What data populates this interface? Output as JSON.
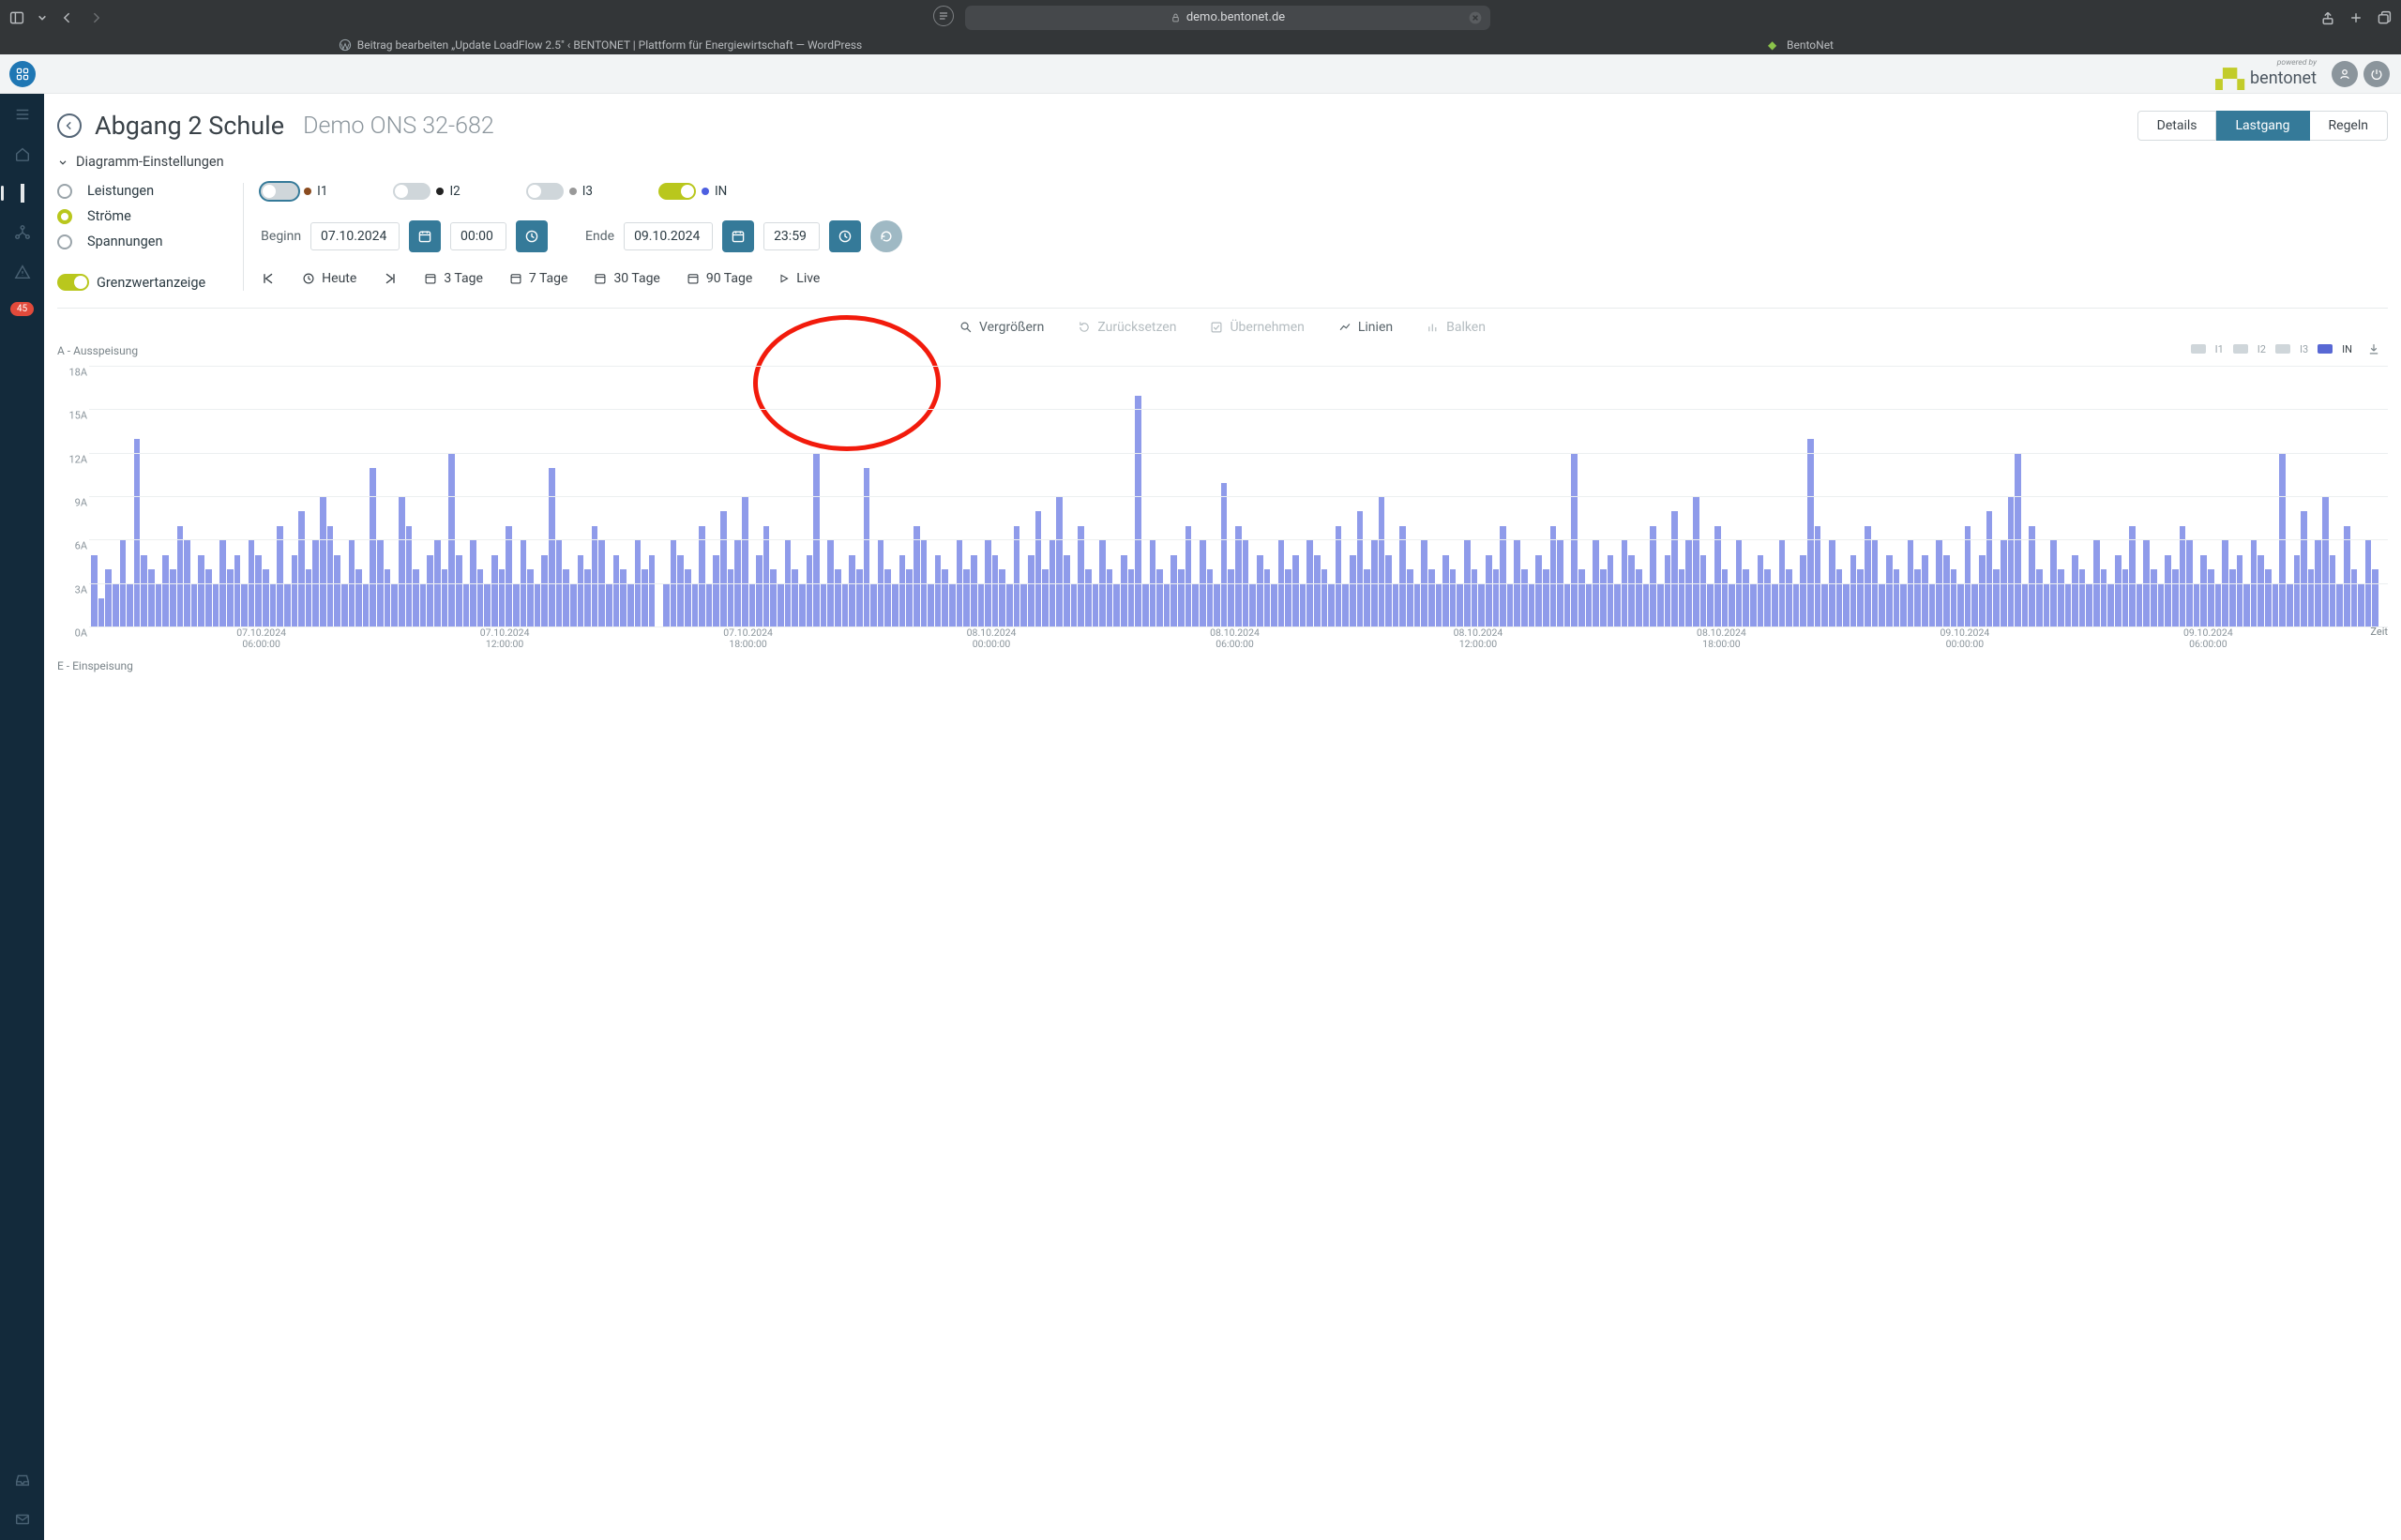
{
  "browser": {
    "url_display": "demo.bentonet.de",
    "tab1": "Beitrag bearbeiten „Update LoadFlow 2.5\" ‹ BENTONET | Plattform für Energiewirtschaft — WordPress",
    "tab2": "BentoNet"
  },
  "header": {
    "powered_by": "powered by",
    "brand": "bentonet"
  },
  "nav": {
    "alert_count": "45"
  },
  "page": {
    "title": "Abgang 2 Schule",
    "subtitle": "Demo ONS 32-682",
    "tabs": {
      "details": "Details",
      "lastgang": "Lastgang",
      "regeln": "Regeln"
    },
    "settings_head": "Diagramm-Einstellungen",
    "radios": {
      "leistungen": "Leistungen",
      "stroeme": "Ströme",
      "spannungen": "Spannungen"
    },
    "grenzwert": "Grenzwertanzeige",
    "channels": {
      "i1": "I1",
      "i2": "I2",
      "i3": "I3",
      "in": "IN"
    },
    "date": {
      "beginn": "Beginn",
      "ende": "Ende",
      "d1": "07.10.2024",
      "t1": "00:00",
      "d2": "09.10.2024",
      "t2": "23:59"
    },
    "quick": {
      "heute": "Heute",
      "d3": "3 Tage",
      "d7": "7 Tage",
      "d30": "30 Tage",
      "d90": "90 Tage",
      "live": "Live"
    },
    "chart_tools": {
      "zoom": "Vergrößern",
      "reset": "Zurücksetzen",
      "apply": "Übernehmen",
      "lines": "Linien",
      "bars": "Balken"
    }
  },
  "chart_data": {
    "type": "bar",
    "title_top": "A - Ausspeisung",
    "title_bottom": "E - Einspeisung",
    "x_label": "Zeit",
    "ylim": [
      0,
      18
    ],
    "y_unit": "A",
    "y_ticks": [
      0,
      3,
      6,
      9,
      12,
      15,
      18
    ],
    "legend": [
      "I1",
      "I2",
      "I3",
      "IN"
    ],
    "legend_active": "IN",
    "x_ticks": [
      {
        "date": "07.10.2024",
        "time": "06:00:00"
      },
      {
        "date": "07.10.2024",
        "time": "12:00:00"
      },
      {
        "date": "07.10.2024",
        "time": "18:00:00"
      },
      {
        "date": "08.10.2024",
        "time": "00:00:00"
      },
      {
        "date": "08.10.2024",
        "time": "06:00:00"
      },
      {
        "date": "08.10.2024",
        "time": "12:00:00"
      },
      {
        "date": "08.10.2024",
        "time": "18:00:00"
      },
      {
        "date": "09.10.2024",
        "time": "00:00:00"
      },
      {
        "date": "09.10.2024",
        "time": "06:00:00"
      }
    ],
    "series": [
      {
        "name": "IN",
        "values": [
          5,
          2,
          4,
          3,
          6,
          3,
          13,
          5,
          4,
          3,
          5,
          4,
          7,
          6,
          3,
          5,
          4,
          3,
          6,
          4,
          5,
          3,
          6,
          5,
          4,
          3,
          7,
          3,
          5,
          8,
          4,
          6,
          9,
          7,
          5,
          3,
          6,
          4,
          3,
          11,
          6,
          4,
          3,
          9,
          7,
          4,
          3,
          5,
          6,
          4,
          12,
          5,
          3,
          6,
          4,
          3,
          5,
          4,
          7,
          3,
          6,
          4,
          3,
          5,
          11,
          6,
          4,
          3,
          5,
          4,
          7,
          6,
          3,
          5,
          4,
          3,
          6,
          4,
          5,
          0,
          3,
          6,
          5,
          4,
          3,
          7,
          3,
          5,
          8,
          4,
          6,
          9,
          3,
          5,
          7,
          4,
          3,
          6,
          4,
          3,
          5,
          12,
          3,
          6,
          4,
          3,
          5,
          4,
          11,
          3,
          6,
          4,
          3,
          5,
          4,
          7,
          6,
          3,
          5,
          4,
          3,
          6,
          4,
          5,
          3,
          6,
          5,
          4,
          3,
          7,
          3,
          5,
          8,
          4,
          6,
          9,
          5,
          3,
          7,
          4,
          3,
          6,
          4,
          3,
          5,
          4,
          16,
          3,
          6,
          4,
          3,
          5,
          4,
          7,
          3,
          6,
          4,
          3,
          10,
          4,
          7,
          6,
          3,
          5,
          4,
          3,
          6,
          4,
          5,
          3,
          6,
          5,
          4,
          3,
          7,
          3,
          5,
          8,
          4,
          6,
          9,
          5,
          3,
          7,
          4,
          3,
          6,
          4,
          3,
          5,
          4,
          3,
          6,
          4,
          3,
          5,
          4,
          7,
          3,
          6,
          4,
          3,
          5,
          4,
          7,
          6,
          3,
          12,
          4,
          3,
          6,
          4,
          5,
          3,
          6,
          5,
          4,
          3,
          7,
          3,
          5,
          8,
          4,
          6,
          9,
          5,
          3,
          7,
          4,
          3,
          6,
          4,
          3,
          5,
          4,
          3,
          6,
          4,
          3,
          5,
          13,
          7,
          3,
          6,
          4,
          3,
          5,
          4,
          7,
          6,
          3,
          5,
          4,
          3,
          6,
          4,
          5,
          3,
          6,
          5,
          4,
          3,
          7,
          3,
          5,
          8,
          4,
          6,
          9,
          12,
          3,
          7,
          4,
          3,
          6,
          4,
          3,
          5,
          4,
          3,
          6,
          4,
          3,
          5,
          4,
          7,
          3,
          6,
          4,
          3,
          5,
          4,
          7,
          6,
          3,
          5,
          4,
          3,
          6,
          4,
          5,
          3,
          6,
          5,
          4,
          3,
          12,
          3,
          5,
          8,
          4,
          6,
          9,
          5,
          3,
          7,
          4,
          3,
          6,
          4
        ]
      }
    ]
  }
}
